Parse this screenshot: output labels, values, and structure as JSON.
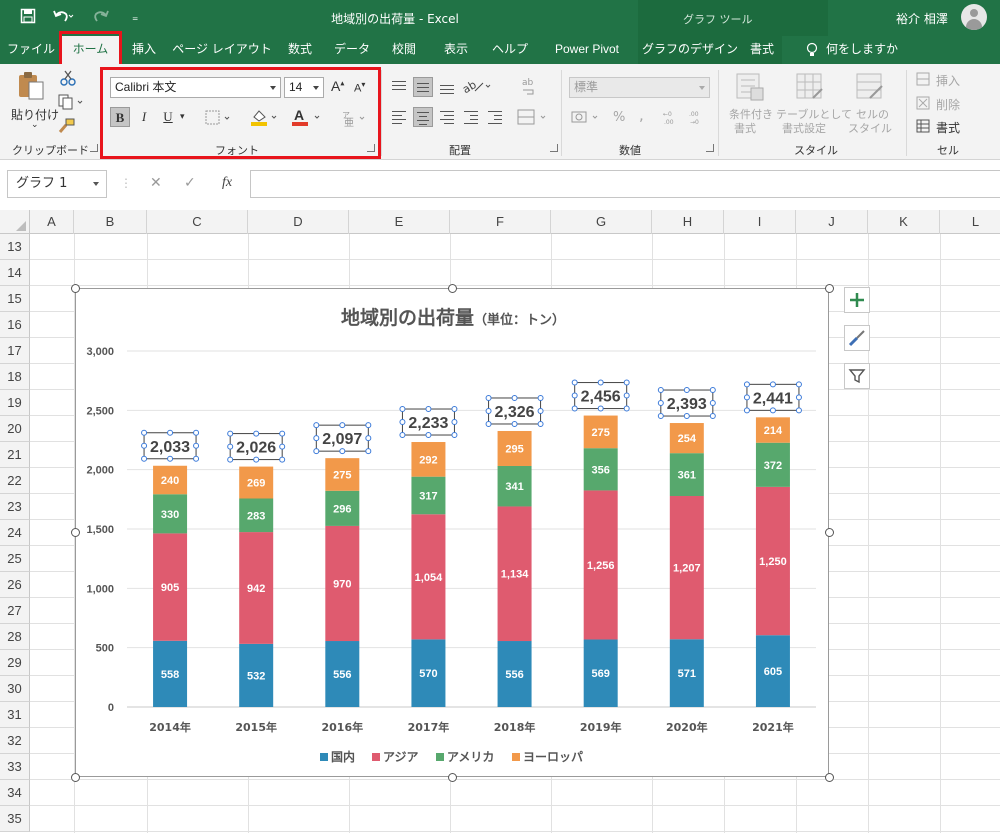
{
  "titlebar": {
    "document_title": "地域別の出荷量  -  Excel",
    "context_tools": "グラフ ツール",
    "user_name": "裕介 相澤",
    "qa_more": "₌"
  },
  "tabs": [
    {
      "label": "ファイル"
    },
    {
      "label": "ホーム"
    },
    {
      "label": "挿入"
    },
    {
      "label": "ページ レイアウト"
    },
    {
      "label": "数式"
    },
    {
      "label": "データ"
    },
    {
      "label": "校閲"
    },
    {
      "label": "表示"
    },
    {
      "label": "ヘルプ"
    },
    {
      "label": "Power Pivot"
    },
    {
      "label": "グラフのデザイン"
    },
    {
      "label": "書式"
    },
    {
      "label": "何をしますか"
    }
  ],
  "ribbon": {
    "clipboard": {
      "paste_label": "貼り付け",
      "group_label": "クリップボード"
    },
    "font": {
      "font_name": "Calibri 本文",
      "font_size": "14",
      "bold": "B",
      "italic": "I",
      "underline": "U",
      "group_label": "フォント",
      "grow": "A",
      "shrink": "A",
      "font_color_letter": "A"
    },
    "alignment": {
      "group_label": "配置"
    },
    "number": {
      "format": "標準",
      "percent": "%",
      "comma": ",",
      "group_label": "数値"
    },
    "styles": {
      "cond_format_l1": "条件付き",
      "cond_format_l2": "書式",
      "as_table_l1": "テーブルとして",
      "as_table_l2": "書式設定",
      "cell_style_l1": "セルの",
      "cell_style_l2": "スタイル",
      "group_label": "スタイル"
    },
    "cells": {
      "insert": "挿入",
      "delete": "削除",
      "format": "書式",
      "group_label": "セル"
    }
  },
  "formula_bar": {
    "name_box": "グラフ 1",
    "fx": "fx",
    "formula": ""
  },
  "grid": {
    "columns": [
      "A",
      "B",
      "C",
      "D",
      "E",
      "F",
      "G",
      "H",
      "I",
      "J",
      "K",
      "L"
    ],
    "rows": [
      "13",
      "14",
      "15",
      "16",
      "17",
      "18",
      "19",
      "20",
      "21",
      "22",
      "23",
      "24",
      "25",
      "26",
      "27",
      "28",
      "29",
      "30",
      "31",
      "32",
      "33",
      "34",
      "35"
    ]
  },
  "chart_data": {
    "type": "bar",
    "stacked": true,
    "title": "地域別の出荷量",
    "subtitle": "（単位：トン）",
    "categories": [
      "2014年",
      "2015年",
      "2016年",
      "2017年",
      "2018年",
      "2019年",
      "2020年",
      "2021年"
    ],
    "series": [
      {
        "name": "国内",
        "color": "#2e8ab8",
        "values": [
          558,
          532,
          556,
          570,
          556,
          569,
          571,
          605
        ]
      },
      {
        "name": "アジア",
        "color": "#df5b6f",
        "values": [
          905,
          942,
          970,
          1054,
          1134,
          1256,
          1207,
          1250
        ]
      },
      {
        "name": "アメリカ",
        "color": "#57a86d",
        "values": [
          330,
          283,
          296,
          317,
          341,
          356,
          361,
          372
        ]
      },
      {
        "name": "ヨーロッパ",
        "color": "#f2994a",
        "values": [
          240,
          269,
          275,
          292,
          295,
          275,
          254,
          214
        ]
      }
    ],
    "totals": [
      "2,033",
      "2,026",
      "2,097",
      "2,233",
      "2,326",
      "2,456",
      "2,393",
      "2,441"
    ],
    "yticks": [
      "0",
      "500",
      "1,000",
      "1,500",
      "2,000",
      "2,500",
      "3,000"
    ],
    "ylim": [
      0,
      3000
    ],
    "grid": true,
    "legend": "bottom"
  }
}
